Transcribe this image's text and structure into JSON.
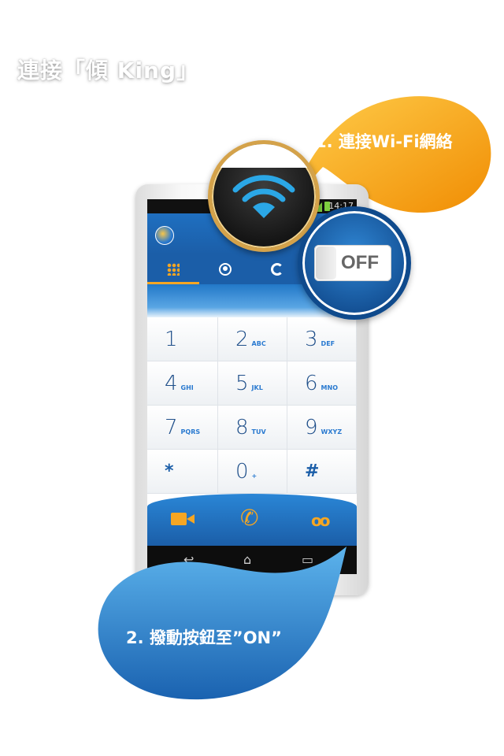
{
  "header": {
    "title": "連接「傾 King」"
  },
  "phone": {
    "status_time": "14:17",
    "tabs": [
      {
        "icon": "dialpad-grid-icon",
        "active": true
      },
      {
        "icon": "contact-person-icon",
        "active": false
      },
      {
        "icon": "call-history-icon",
        "active": false
      }
    ],
    "keypad": [
      {
        "digit": "1",
        "letters": ""
      },
      {
        "digit": "2",
        "letters": "ABC"
      },
      {
        "digit": "3",
        "letters": "DEF"
      },
      {
        "digit": "4",
        "letters": "GHI"
      },
      {
        "digit": "5",
        "letters": "JKL"
      },
      {
        "digit": "6",
        "letters": "MNO"
      },
      {
        "digit": "7",
        "letters": "PQRS"
      },
      {
        "digit": "8",
        "letters": "TUV"
      },
      {
        "digit": "9",
        "letters": "WXYZ"
      },
      {
        "digit": "*",
        "letters": ""
      },
      {
        "digit": "0",
        "letters": "+"
      },
      {
        "digit": "#",
        "letters": ""
      }
    ],
    "call_actions": [
      "video-call-icon",
      "voice-call-icon",
      "voicemail-icon"
    ],
    "nav": [
      "back-icon",
      "home-icon",
      "recent-apps-icon"
    ]
  },
  "toggle": {
    "label": "OFF"
  },
  "steps": {
    "step1": "1. 連接Wi-Fi網絡",
    "step2": "2. 撥動按鈕至”ON”"
  },
  "colors": {
    "accent_orange": "#f5a623",
    "brand_blue": "#1b5ea8",
    "gold_ring": "#d4a24a"
  }
}
